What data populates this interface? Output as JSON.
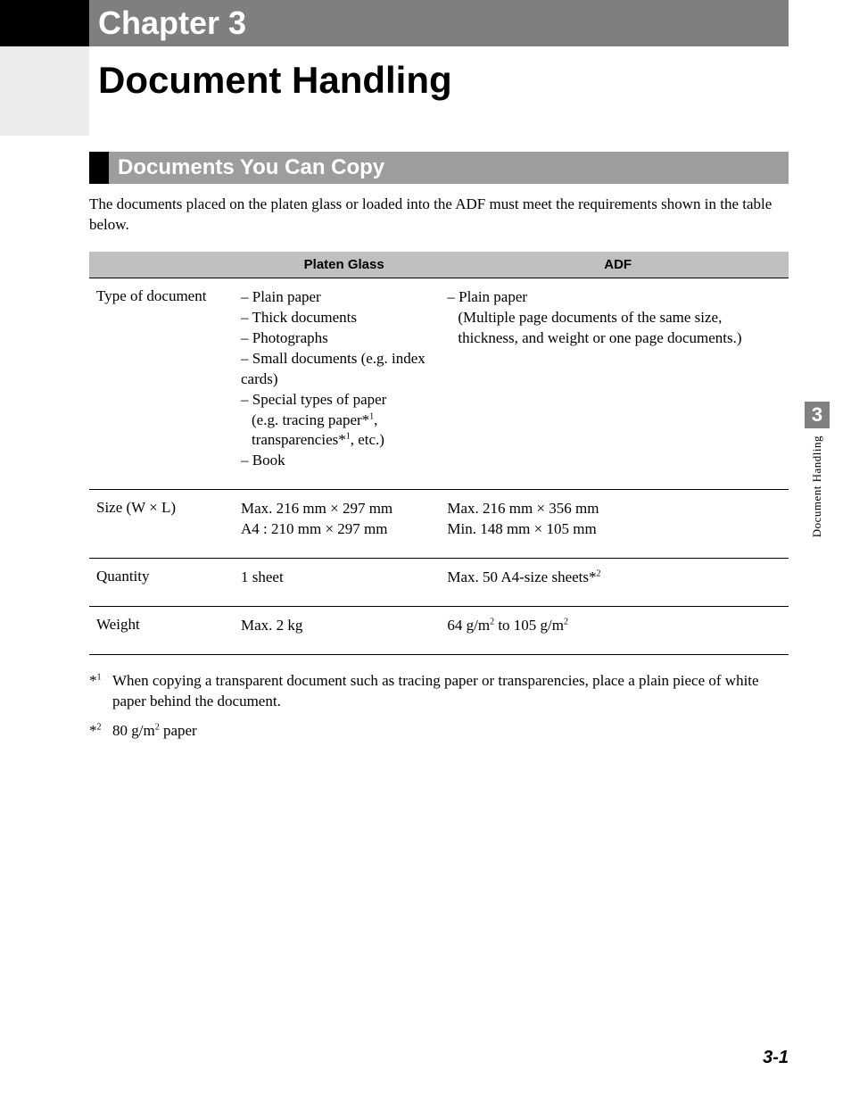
{
  "banner": {
    "chapter_label": "Chapter 3",
    "title": "Document Handling"
  },
  "section": {
    "heading": "Documents You Can Copy",
    "intro": "The documents placed on the platen glass or loaded into the ADF must meet the requirements shown in the table below."
  },
  "table": {
    "head": {
      "col1": "",
      "col2": "Platen Glass",
      "col3": "ADF"
    },
    "rows": [
      {
        "label": "Type of document",
        "platen": [
          "– Plain paper",
          "– Thick documents",
          "– Photographs",
          "– Small documents (e.g. index cards)",
          "– Special types of paper",
          "  (e.g. tracing paper*¹, transparencies*¹, etc.)",
          "– Book"
        ],
        "adf": [
          "– Plain paper",
          "  (Multiple page documents of the same size, thickness, and weight or one page documents.)"
        ]
      },
      {
        "label": "Size (W × L)",
        "platen": [
          "Max. 216 mm × 297 mm",
          "A4 : 210 mm × 297 mm"
        ],
        "adf": [
          "Max. 216 mm × 356 mm",
          "Min. 148 mm × 105 mm"
        ]
      },
      {
        "label": "Quantity",
        "platen": [
          "1 sheet"
        ],
        "adf": [
          "Max. 50 A4-size sheets*²"
        ]
      },
      {
        "label": "Weight",
        "platen": [
          "Max. 2 kg"
        ],
        "adf": [
          "64 g/m² to 105 g/m²"
        ]
      }
    ]
  },
  "footnotes": [
    {
      "mark": "*¹",
      "text": "When copying a transparent document such as tracing paper or transparencies, place a plain piece of white paper behind the document."
    },
    {
      "mark": "*²",
      "text": "80 g/m² paper"
    }
  ],
  "sidetab": {
    "number": "3",
    "label": "Document Handling"
  },
  "page_number": "3-1"
}
